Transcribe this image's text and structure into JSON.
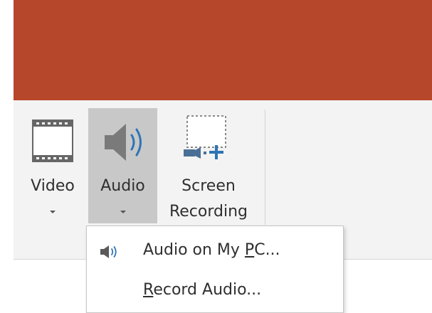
{
  "ribbon": {
    "buttons": {
      "video": {
        "label": "Video",
        "icon": "film-strip-icon"
      },
      "audio": {
        "label": "Audio",
        "icon": "speaker-icon"
      },
      "screen_recording": {
        "label_line1": "Screen",
        "label_line2": "Recording",
        "icon": "screen-recording-icon"
      }
    }
  },
  "audio_menu": {
    "items": [
      {
        "text_before": "Audio on My ",
        "underlined": "P",
        "text_after": "C...",
        "icon": "speaker-small-icon"
      },
      {
        "text_before": "",
        "underlined": "R",
        "text_after": "ecord Audio...",
        "icon": ""
      }
    ]
  },
  "colors": {
    "title_bar": "#b7472a",
    "ribbon_bg": "#f3f3f3",
    "pressed_button": "#c8c8c8",
    "icon_blue": "#2e74b5",
    "icon_gray": "#7a7a7a"
  }
}
